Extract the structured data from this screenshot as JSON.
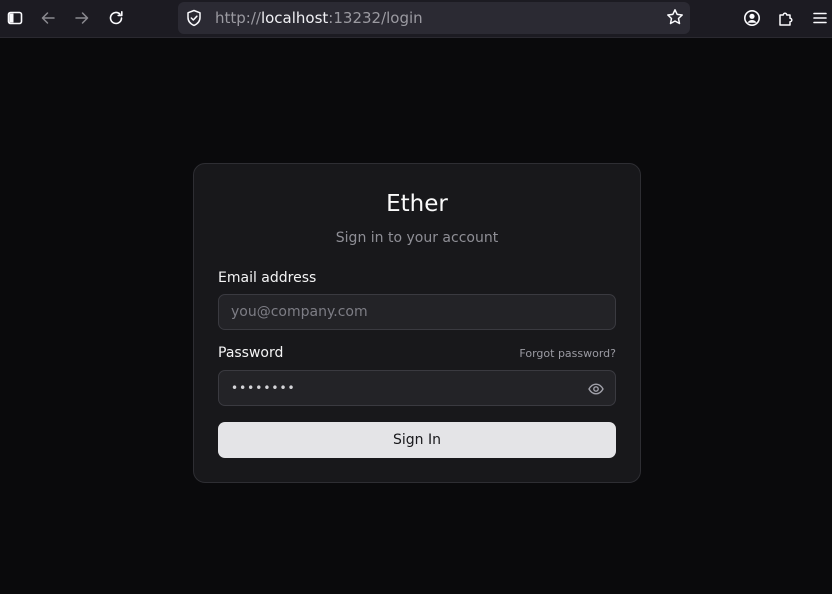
{
  "browser": {
    "url_scheme": "http://",
    "url_host": "localhost",
    "url_rest": ":13232/login"
  },
  "login": {
    "title": "Ether",
    "subtitle": "Sign in to your account",
    "email_label": "Email address",
    "email_placeholder": "you@company.com",
    "email_value": "",
    "password_label": "Password",
    "forgot_label": "Forgot password?",
    "password_value": "password",
    "submit_label": "Sign In"
  }
}
